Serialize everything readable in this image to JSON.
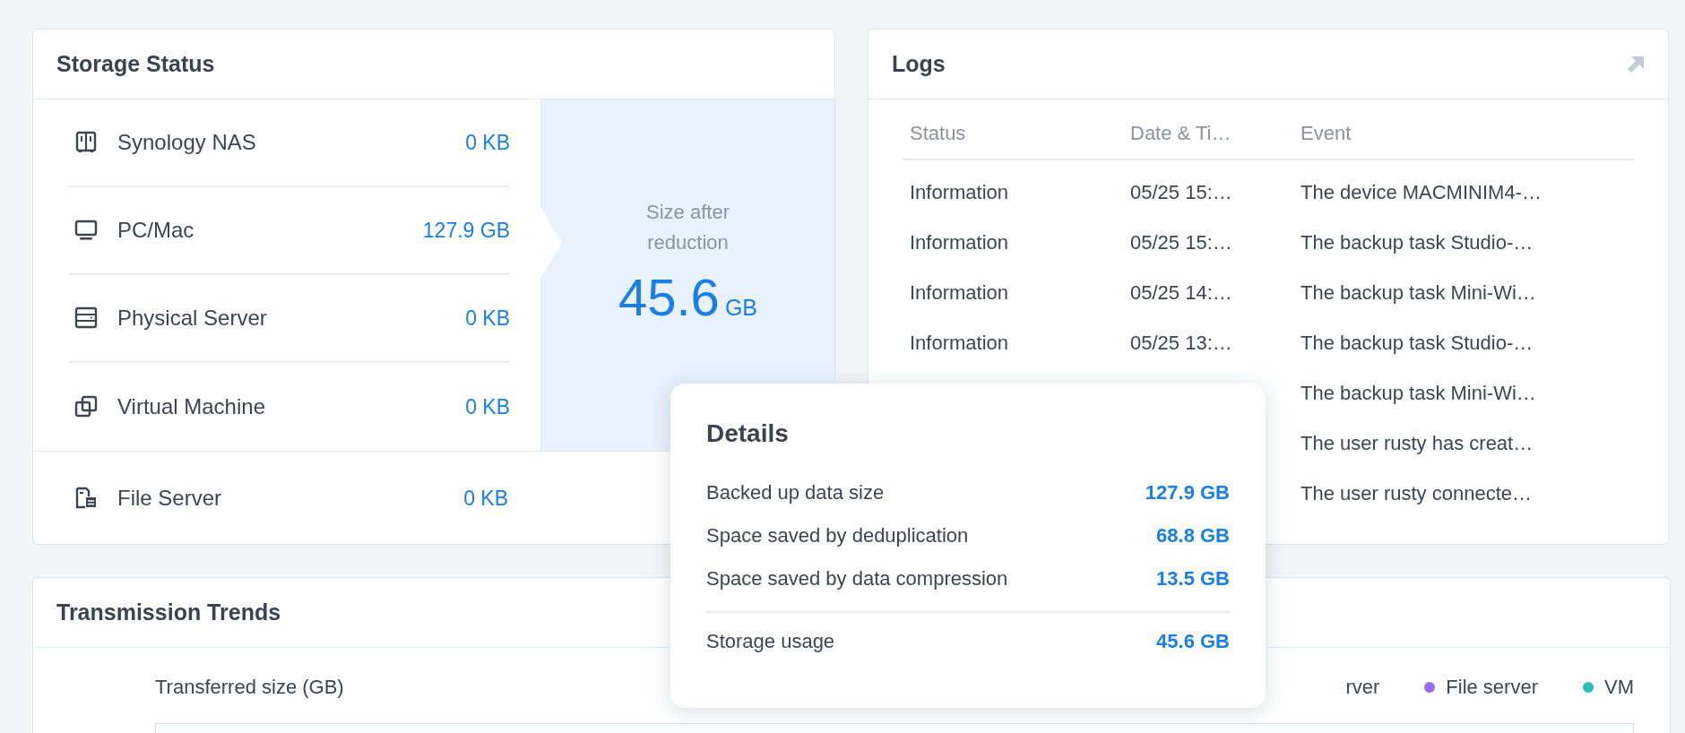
{
  "storage_status": {
    "title": "Storage Status",
    "sources": [
      {
        "name": "Synology NAS",
        "size": "0 KB"
      },
      {
        "name": "PC/Mac",
        "size": "127.9 GB"
      },
      {
        "name": "Physical Server",
        "size": "0 KB"
      },
      {
        "name": "Virtual Machine",
        "size": "0 KB"
      }
    ],
    "reduction": {
      "label": "Size after reduction",
      "value": "45.6",
      "unit": "GB"
    },
    "file_server": {
      "name": "File Server",
      "size": "0 KB"
    }
  },
  "logs": {
    "title": "Logs",
    "columns": [
      "Status",
      "Date & Ti…",
      "Event"
    ],
    "rows": [
      {
        "status": "Information",
        "date": "05/25 15:…",
        "event": "The device MACMINIM4-…"
      },
      {
        "status": "Information",
        "date": "05/25 15:…",
        "event": "The backup task Studio-…"
      },
      {
        "status": "Information",
        "date": "05/25 14:…",
        "event": "The backup task Mini-Wi…"
      },
      {
        "status": "Information",
        "date": "05/25 13:…",
        "event": "The backup task Studio-…"
      },
      {
        "event": "The backup task Mini-Wi…"
      },
      {
        "event": "The user rusty has creat…"
      },
      {
        "event": "The user rusty connecte…"
      }
    ]
  },
  "transmission_trends": {
    "title": "Transmission Trends",
    "axis_label": "Transferred size (GB)",
    "legend": [
      {
        "label": "rver"
      },
      {
        "label": "File server",
        "color": "#9b6cf0"
      },
      {
        "label": "VM",
        "color": "#2bbdb8"
      }
    ]
  },
  "details_popover": {
    "title": "Details",
    "rows": [
      {
        "label": "Backed up data size",
        "value": "127.9 GB"
      },
      {
        "label": "Space saved by deduplication",
        "value": "68.8 GB"
      },
      {
        "label": "Space saved by data compression",
        "value": "13.5 GB"
      }
    ],
    "total": {
      "label": "Storage usage",
      "value": "45.6 GB"
    }
  }
}
